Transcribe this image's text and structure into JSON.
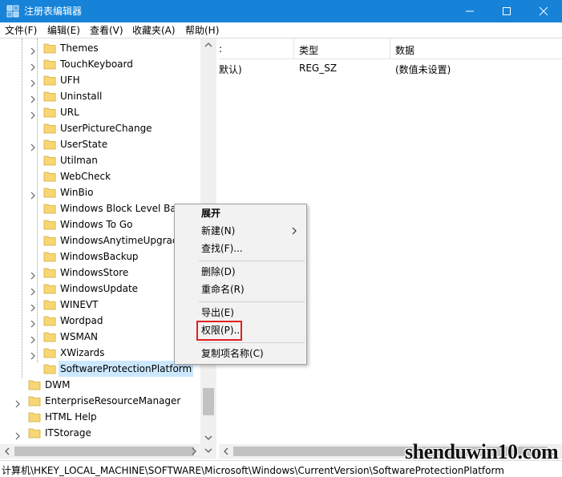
{
  "window": {
    "title": "注册表编辑器",
    "controls": {
      "minimize": "minimize-icon",
      "maximize": "maximize-icon",
      "close": "close-icon"
    }
  },
  "menu": [
    "文件(F)",
    "编辑(E)",
    "查看(V)",
    "收藏夹(A)",
    "帮助(H)"
  ],
  "tree": {
    "items": [
      {
        "label": "Themes",
        "expandable": true
      },
      {
        "label": "TouchKeyboard",
        "expandable": true
      },
      {
        "label": "UFH",
        "expandable": true
      },
      {
        "label": "Uninstall",
        "expandable": true
      },
      {
        "label": "URL",
        "expandable": true
      },
      {
        "label": "UserPictureChange",
        "expandable": false
      },
      {
        "label": "UserState",
        "expandable": true
      },
      {
        "label": "Utilman",
        "expandable": false
      },
      {
        "label": "WebCheck",
        "expandable": false
      },
      {
        "label": "WinBio",
        "expandable": true
      },
      {
        "label": "Windows Block Level Ba",
        "expandable": false
      },
      {
        "label": "Windows To Go",
        "expandable": false
      },
      {
        "label": "WindowsAnytimeUpgrac",
        "expandable": false
      },
      {
        "label": "WindowsBackup",
        "expandable": false
      },
      {
        "label": "WindowsStore",
        "expandable": true
      },
      {
        "label": "WindowsUpdate",
        "expandable": true
      },
      {
        "label": "WINEVT",
        "expandable": true
      },
      {
        "label": "Wordpad",
        "expandable": true
      },
      {
        "label": "WSMAN",
        "expandable": true
      },
      {
        "label": "XWizards",
        "expandable": true
      },
      {
        "label": "SoftwareProtectionPlatform",
        "expandable": false,
        "selected": true
      }
    ],
    "parent_items": [
      {
        "label": "DWM",
        "expandable": false
      },
      {
        "label": "EnterpriseResourceManager",
        "expandable": true
      },
      {
        "label": "HTML Help",
        "expandable": false
      },
      {
        "label": "ITStorage",
        "expandable": true
      }
    ]
  },
  "list": {
    "columns": [
      ":",
      "类型",
      "数据"
    ],
    "rows": [
      {
        "name": "默认)",
        "type": "REG_SZ",
        "data": "(数值未设置)"
      }
    ]
  },
  "context_menu": {
    "items": [
      {
        "label": "展开",
        "bold": true
      },
      {
        "label": "新建(N)",
        "submenu": true
      },
      {
        "label": "查找(F)..."
      },
      {
        "label": "删除(D)"
      },
      {
        "label": "重命名(R)"
      },
      {
        "label": "导出(E)"
      },
      {
        "label": "权限(P)...",
        "highlighted": true
      },
      {
        "label": "复制项名称(C)"
      }
    ],
    "highlight_color": "#e02020"
  },
  "status": {
    "path": "计算机\\HKEY_LOCAL_MACHINE\\SOFTWARE\\Microsoft\\Windows\\CurrentVersion\\SoftwareProtectionPlatform"
  },
  "watermark": "shenduwin10.com",
  "colors": {
    "titlebar": "#1683d8",
    "selection": "#cce8ff",
    "folder": "#f7d774"
  }
}
